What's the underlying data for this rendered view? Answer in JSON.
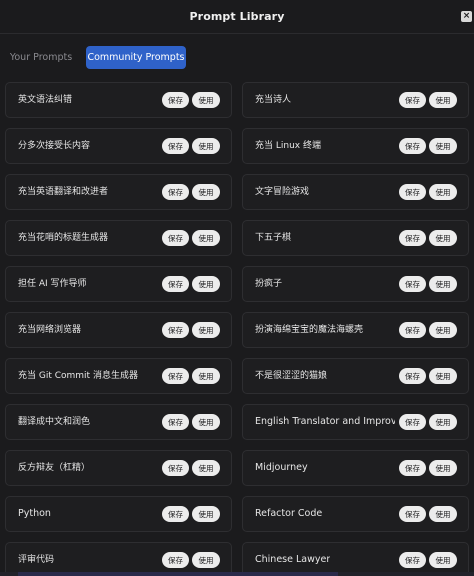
{
  "header": {
    "title": "Prompt Library",
    "close_icon": "close-icon",
    "close_glyph": "×"
  },
  "tabs": [
    {
      "label": "Your Prompts",
      "active": false
    },
    {
      "label": "Community Prompts",
      "active": true
    }
  ],
  "actions": {
    "save_label": "保存",
    "use_label": "使用"
  },
  "prompts": [
    "英文语法纠错",
    "充当诗人",
    "分多次接受长内容",
    "充当 Linux 终端",
    "充当英语翻译和改进者",
    "文字冒险游戏",
    "充当花哨的标题生成器",
    "下五子棋",
    "担任 AI 写作导师",
    "扮疯子",
    "充当网络浏览器",
    "扮演海绵宝宝的魔法海螺壳",
    "充当 Git Commit 消息生成器",
    "不是很涩涩的猫娘",
    "翻译成中文和润色",
    "English Translator and Improver",
    "反方辩友（杠精）",
    "Midjourney",
    "Python",
    "Refactor Code",
    "评审代码",
    "Chinese Lawyer"
  ],
  "colors": {
    "accent": "#2f62c9",
    "background": "#1b1b1d",
    "pill": "#ececec"
  }
}
